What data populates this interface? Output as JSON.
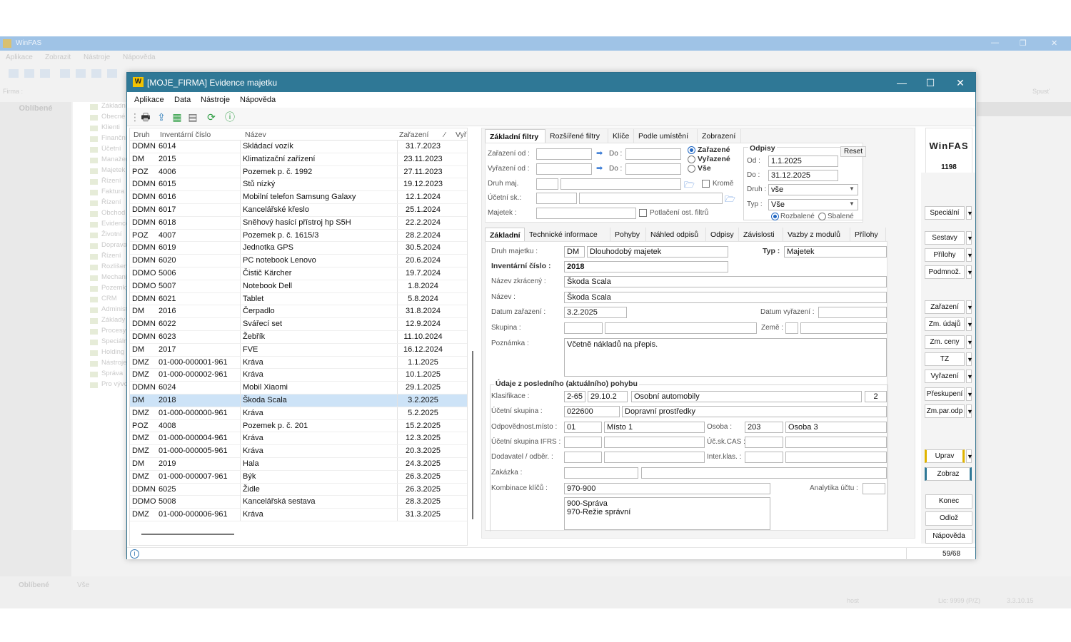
{
  "bg": {
    "title": "WinFAS",
    "menu": [
      "Aplikace",
      "Zobrazit",
      "Nástroje",
      "Nápověda"
    ],
    "firma_label": "Firma :",
    "oblibene": "Oblíbené",
    "tree": [
      "Základní funkce",
      "Obecné",
      "Klienti",
      "Finanční",
      "Účetní",
      "Manažer",
      "Majetek",
      "Řízení",
      "Faktura",
      "Řízení",
      "Obchod",
      "Evidence",
      "Životní",
      "Doprava",
      "Řízení",
      "Rozlišení",
      "Mechanizace",
      "Pozemky",
      "CRM",
      "Administrace",
      "Základy",
      "Procesy",
      "Speciální",
      "Holding",
      "Nástroje",
      "Správa",
      "Pro vývoj"
    ],
    "spust": "Spusť",
    "bottom_left": "Oblíbené",
    "bottom_vse": "Vše",
    "status_host": "host",
    "status_lic": "Lic: 9999 (P/Z)",
    "status_ver": "3.3.10.15"
  },
  "window": {
    "title": "[MOJE_FIRMA] Evidence majetku",
    "menu": [
      "Aplikace",
      "Data",
      "Nástroje",
      "Nápověda"
    ]
  },
  "list": {
    "headers": [
      "Druh",
      "Inventární číslo",
      "Název",
      "Zařazení",
      "Vyř"
    ],
    "rows": [
      [
        "DDMN",
        "6014",
        "Skládací vozík",
        "31.7.2023"
      ],
      [
        "DM",
        "2015",
        "Klimatizační zařízení",
        "23.11.2023"
      ],
      [
        "POZ",
        "4006",
        "Pozemek p. č. 1992",
        "27.11.2023"
      ],
      [
        "DDMN",
        "6015",
        "Stů nízký",
        "19.12.2023"
      ],
      [
        "DDMN",
        "6016",
        "Mobilní telefon Samsung Galaxy",
        "12.1.2024"
      ],
      [
        "DDMN",
        "6017",
        "Kancelářské křeslo",
        "25.1.2024"
      ],
      [
        "DDMN",
        "6018",
        "Sněhový hasící přístroj hp S5H",
        "22.2.2024"
      ],
      [
        "POZ",
        "4007",
        "Pozemek p. č. 1615/3",
        "28.2.2024"
      ],
      [
        "DDMN",
        "6019",
        "Jednotka GPS",
        "30.5.2024"
      ],
      [
        "DDMN",
        "6020",
        "PC notebook Lenovo",
        "20.6.2024"
      ],
      [
        "DDMO",
        "5006",
        "Čistič Kärcher",
        "19.7.2024"
      ],
      [
        "DDMO",
        "5007",
        "Notebook Dell",
        "1.8.2024"
      ],
      [
        "DDMN",
        "6021",
        "Tablet",
        "5.8.2024"
      ],
      [
        "DM",
        "2016",
        "Čerpadlo",
        "31.8.2024"
      ],
      [
        "DDMN",
        "6022",
        "Svářecí set",
        "12.9.2024"
      ],
      [
        "DDMN",
        "6023",
        "Žebřík",
        "11.10.2024"
      ],
      [
        "DM",
        "2017",
        "FVE",
        "16.12.2024"
      ],
      [
        "DMZ",
        "01-000-000001-961",
        "Kráva",
        "1.1.2025"
      ],
      [
        "DMZ",
        "01-000-000002-961",
        "Kráva",
        "10.1.2025"
      ],
      [
        "DDMN",
        "6024",
        "Mobil Xiaomi",
        "29.1.2025"
      ],
      [
        "DM",
        "2018",
        "Škoda Scala",
        "3.2.2025"
      ],
      [
        "DMZ",
        "01-000-000000-961",
        "Kráva",
        "5.2.2025"
      ],
      [
        "POZ",
        "4008",
        "Pozemek p. č. 201",
        "15.2.2025"
      ],
      [
        "DMZ",
        "01-000-000004-961",
        "Kráva",
        "12.3.2025"
      ],
      [
        "DMZ",
        "01-000-000005-961",
        "Kráva",
        "20.3.2025"
      ],
      [
        "DM",
        "2019",
        "Hala",
        "24.3.2025"
      ],
      [
        "DMZ",
        "01-000-000007-961",
        "Býk",
        "26.3.2025"
      ],
      [
        "DDMN",
        "6025",
        "Židle",
        "26.3.2025"
      ],
      [
        "DDMO",
        "5008",
        "Kancelářská sestava",
        "28.3.2025"
      ],
      [
        "DMZ",
        "01-000-000006-961",
        "Kráva",
        "31.3.2025"
      ]
    ],
    "selected_index": 20
  },
  "filter_tabs": [
    "Základní filtry",
    "Rozšířené filtry",
    "Klíče",
    "Podle umístění",
    "Zobrazení"
  ],
  "filters": {
    "zarazeni_od": "Zařazení od :",
    "vyrazeni_od": "Vyřazení od :",
    "do": "Do :",
    "druh_maj": "Druh maj.",
    "ucetni_sk": "Účetní sk.:",
    "majetek": "Majetek :",
    "krome": "Kromě",
    "potlaceni": "Potlačení ost. filtrů",
    "radio_zarazene": "Zařazené",
    "radio_vyrazene": "Vyřazené",
    "radio_vse": "Vše",
    "odpisy_title": "Odpisy",
    "reset": "Reset",
    "od_label": "Od :",
    "od_value": "1.1.2025",
    "do_label": "Do :",
    "do_value": "31.12.2025",
    "druh_label": "Druh :",
    "druh_value": "vše",
    "typ_label": "Typ :",
    "typ_value": "Vše",
    "rozbalene": "Rozbalené",
    "sbalene": "Sbalené"
  },
  "detail_tabs": [
    "Základní",
    "Technické informace",
    "Pohyby",
    "Náhled odpisů",
    "Odpisy",
    "Závislosti",
    "Vazby z modulů",
    "Přílohy"
  ],
  "detail": {
    "druh_label": "Druh majetku :",
    "druh_code": "DM",
    "druh_name": "Dlouhodobý majetek",
    "typ_label": "Typ :",
    "typ_value": "Majetek",
    "inv_label": "Inventární číslo :",
    "inv_value": "2018",
    "nazev_zkr_label": "Název zkrácený :",
    "nazev_zkr_value": "Škoda Scala",
    "nazev_label": "Název :",
    "nazev_value": "Škoda Scala",
    "datum_zar_label": "Datum zařazení :",
    "datum_zar_value": "3.2.2025",
    "datum_vyr_label": "Datum vyřazení :",
    "skupina_label": "Skupina :",
    "zeme_label": "Země :",
    "poznamka_label": "Poznámka :",
    "poznamka_value": "Včetně nákladů na přepis.",
    "pohyb_title": "Údaje z posledního (aktuálního) pohybu",
    "klasifikace_label": "Klasifikace :",
    "klasifikace_code": "2-65",
    "klasifikace_date": "29.10.2",
    "klasifikace_name": "Osobní automobily",
    "klasifikace_num": "2",
    "ucetni_sk_label": "Účetní skupina :",
    "ucetni_sk_code": "022600",
    "ucetni_sk_name": "Dopravní prostředky",
    "odp_misto_label": "Odpovědnost.místo :",
    "odp_misto_code": "01",
    "odp_misto_name": "Místo 1",
    "osoba_label": "Osoba :",
    "osoba_code": "203",
    "osoba_name": "Osoba 3",
    "ifrs_label": "Účetní skupina IFRS :",
    "uc_cas_label": "Úč.sk.CAS :",
    "dodavatel_label": "Dodavatel / odběr. :",
    "inter_label": "Inter.klas. :",
    "zakazka_label": "Zakázka :",
    "kombinace_label": "Kombinace klíčů :",
    "kombinace_value": "970-900",
    "analytika_label": "Analytika účtu :",
    "kombinace_detail": "900-Správa\n970-Režie správní"
  },
  "logo": {
    "name": "WinFAS",
    "number": "1198"
  },
  "side_buttons": [
    "Speciální",
    "Sestavy",
    "Přílohy",
    "Podmnož.",
    "Zařazení",
    "Zm. údajů",
    "Zm. ceny",
    "TZ",
    "Vyřazení",
    "Přeskupení",
    "Zm.par.odp",
    "Uprav",
    "Zobraz",
    "Konec",
    "Odlož",
    "Nápověda"
  ],
  "record_count": "59/68",
  "accent": "#2f7896",
  "select_color": "#cde3f7"
}
